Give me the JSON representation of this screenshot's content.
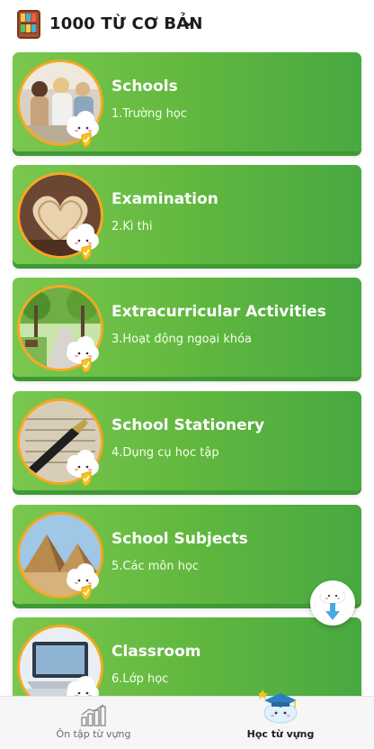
{
  "header": {
    "title": "1000 TỪ CƠ BẢN"
  },
  "lessons": [
    {
      "title": "Schools",
      "subtitle": "1.Trường học"
    },
    {
      "title": "Examination",
      "subtitle": "2.Kì thi"
    },
    {
      "title": "Extracurricular Activities",
      "subtitle": "3.Hoạt động ngoại khóa"
    },
    {
      "title": "School Stationery",
      "subtitle": "4.Dụng cụ học tập"
    },
    {
      "title": "School Subjects",
      "subtitle": "5.Các môn học"
    },
    {
      "title": "Classroom",
      "subtitle": "6.Lớp học"
    }
  ],
  "bottom_nav": {
    "items": [
      {
        "label": "Ôn tập từ vựng",
        "icon": "bar-chart-icon",
        "active": false
      },
      {
        "label": "Học từ vựng",
        "icon": "graduation-cap-icon",
        "active": true
      }
    ]
  },
  "colors": {
    "card_green": "#62b83f",
    "ring_orange": "#f5a81e",
    "fab_arrow": "#4aa8e6"
  }
}
